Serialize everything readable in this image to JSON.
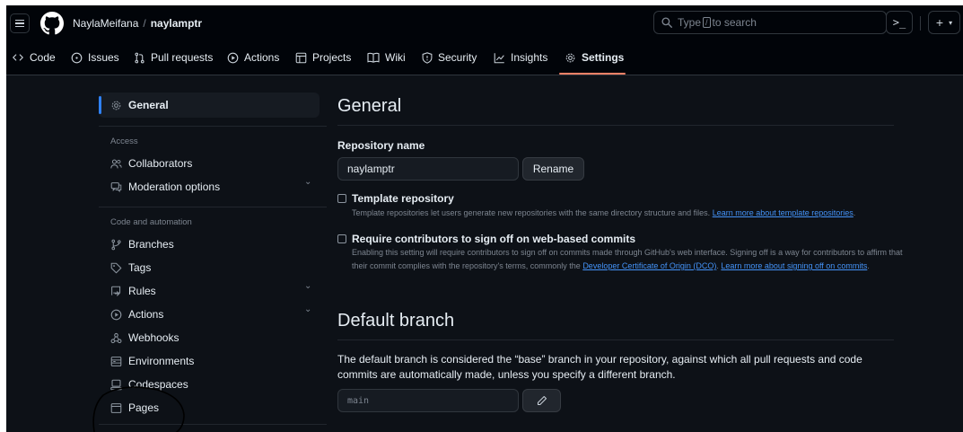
{
  "header": {
    "owner": "NaylaMeifana",
    "separator": "/",
    "repo": "naylamptr",
    "search_prefix": "Type",
    "search_key": "/",
    "search_suffix": "to search",
    "command_palette_label": ">_",
    "plus_label": "+",
    "plus_caret": "▾"
  },
  "nav": {
    "tabs": [
      {
        "label": "Code"
      },
      {
        "label": "Issues"
      },
      {
        "label": "Pull requests"
      },
      {
        "label": "Actions"
      },
      {
        "label": "Projects"
      },
      {
        "label": "Wiki"
      },
      {
        "label": "Security"
      },
      {
        "label": "Insights"
      },
      {
        "label": "Settings"
      }
    ],
    "active_tab": "Settings"
  },
  "sidebar": {
    "general": "General",
    "access_heading": "Access",
    "collaborators": "Collaborators",
    "moderation": "Moderation options",
    "automation_heading": "Code and automation",
    "branches": "Branches",
    "tags": "Tags",
    "rules": "Rules",
    "actions": "Actions",
    "webhooks": "Webhooks",
    "environments": "Environments",
    "codespaces": "Codespaces",
    "pages": "Pages",
    "chevron": "⌄"
  },
  "main": {
    "title": "General",
    "repo_name_label": "Repository name",
    "repo_name_value": "naylamptr",
    "rename_button": "Rename",
    "template_title": "Template repository",
    "template_desc": "Template repositories let users generate new repositories with the same directory structure and files.",
    "template_link": "Learn more about template repositories",
    "template_end": ".",
    "signoff_title": "Require contributors to sign off on web-based commits",
    "signoff_desc_1": "Enabling this setting will require contributors to sign off on commits made through GitHub's web interface. Signing off is a way for contributors to affirm that their commit complies with the repository's terms, commonly the",
    "signoff_link_1": "Developer Certificate of Origin (DCO)",
    "signoff_dot": ".",
    "signoff_link_2": "Learn more about signing off on commits",
    "signoff_end": ".",
    "default_branch_title": "Default branch",
    "default_branch_desc": "The default branch is considered the “base” branch in your repository, against which all pull requests and code commits are automatically made, unless you specify a different branch.",
    "branch_value": "main"
  },
  "colors": {
    "background": "#0d1117",
    "header": "#010409",
    "accent_underline": "#f78166",
    "active_indicator": "#2f81f7",
    "link": "#4493f8",
    "muted": "#7d8590"
  }
}
